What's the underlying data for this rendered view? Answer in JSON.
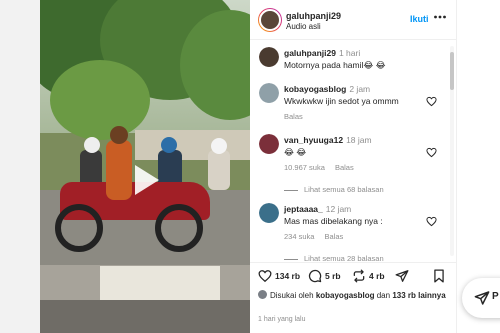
{
  "post": {
    "username": "galuhpanji29",
    "audio": "Audio asli",
    "follow_label": "Ikuti",
    "more_icon": "more-horizontal-icon"
  },
  "comments": [
    {
      "user": "galuhpanji29",
      "time": "1 hari",
      "text": "Motornya pada hamil😂 😂",
      "avatar_color": "#4a3b30"
    },
    {
      "user": "kobayogasblog",
      "time": "2 jam",
      "text": "Wkwkwkw ijin sedot ya ommm",
      "reply": "Balas",
      "avatar_color": "#8fa0a8"
    },
    {
      "user": "van_hyuuga12",
      "time": "18 jam",
      "text": "😂 😂",
      "likes": "10.967 suka",
      "reply": "Balas",
      "see_replies": "Lihat semua 68 balasan",
      "avatar_color": "#7b2f3a"
    },
    {
      "user": "jeptaaaa_",
      "time": "12 jam",
      "text": "Mas mas dibelakang nya :",
      "likes": "234 suka",
      "reply": "Balas",
      "see_replies": "Lihat semua 28 balasan",
      "avatar_color": "#3b6f8a"
    }
  ],
  "actions": {
    "likes": "134 rb",
    "comments": "5 rb",
    "reposts": "4 rb"
  },
  "liked_by": {
    "prefix": "Disukai oleh",
    "user": "kobayogasblog",
    "connector": "dan",
    "others": "133 rb lainnya"
  },
  "timestamp": "1 hari yang lalu",
  "floating": {
    "label": "P"
  },
  "colors": {
    "accent": "#0095f6",
    "text": "#262626",
    "muted": "#8e8e8e"
  }
}
